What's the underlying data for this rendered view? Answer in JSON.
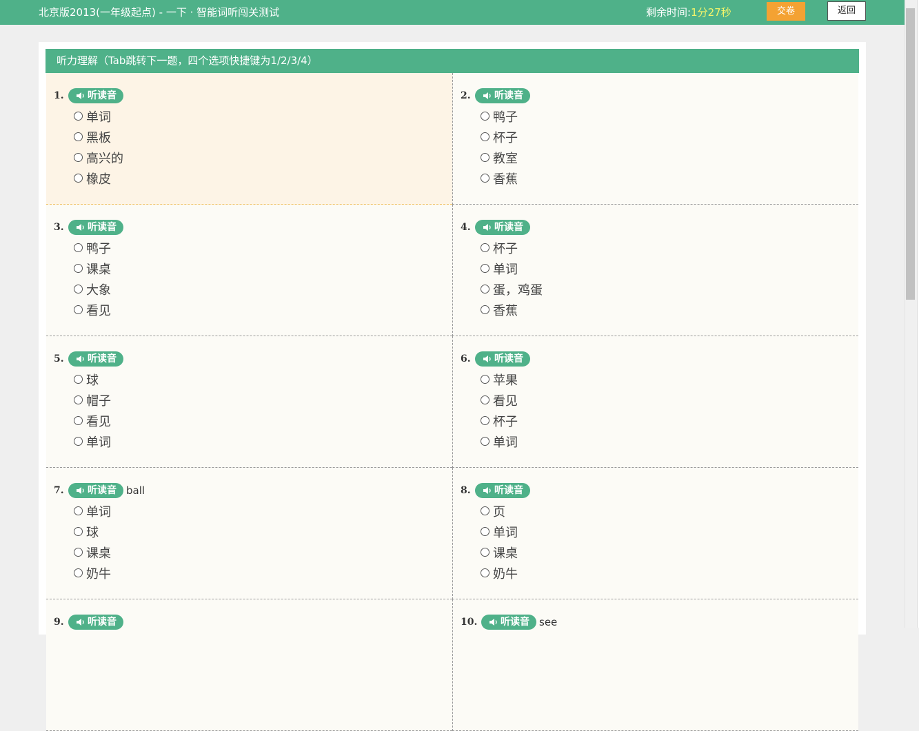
{
  "header": {
    "title": "北京版2013(一年级起点) - 一下 · 智能词听闯关测试",
    "time_label": "剩余时间:",
    "time_value": "1分27秒",
    "submit_label": "交卷",
    "back_label": "返回"
  },
  "section": {
    "title": "听力理解（Tab跳转下一题，四个选项快捷键为1/2/3/4）"
  },
  "listen_label": "听读音",
  "questions": [
    {
      "num": "1.",
      "hint": "",
      "options": [
        "单词",
        "黑板",
        "高兴的",
        "橡皮"
      ]
    },
    {
      "num": "2.",
      "hint": "",
      "options": [
        "鸭子",
        "杯子",
        "教室",
        "香蕉"
      ]
    },
    {
      "num": "3.",
      "hint": "",
      "options": [
        "鸭子",
        "课桌",
        "大象",
        "看见"
      ]
    },
    {
      "num": "4.",
      "hint": "",
      "options": [
        "杯子",
        "单词",
        "蛋，鸡蛋",
        "香蕉"
      ]
    },
    {
      "num": "5.",
      "hint": "",
      "options": [
        "球",
        "帽子",
        "看见",
        "单词"
      ]
    },
    {
      "num": "6.",
      "hint": "",
      "options": [
        "苹果",
        "看见",
        "杯子",
        "单词"
      ]
    },
    {
      "num": "7.",
      "hint": "ball",
      "options": [
        "单词",
        "球",
        "课桌",
        "奶牛"
      ]
    },
    {
      "num": "8.",
      "hint": "",
      "options": [
        "页",
        "单词",
        "课桌",
        "奶牛"
      ]
    },
    {
      "num": "9.",
      "hint": "",
      "options": []
    },
    {
      "num": "10.",
      "hint": "see",
      "options": []
    }
  ]
}
